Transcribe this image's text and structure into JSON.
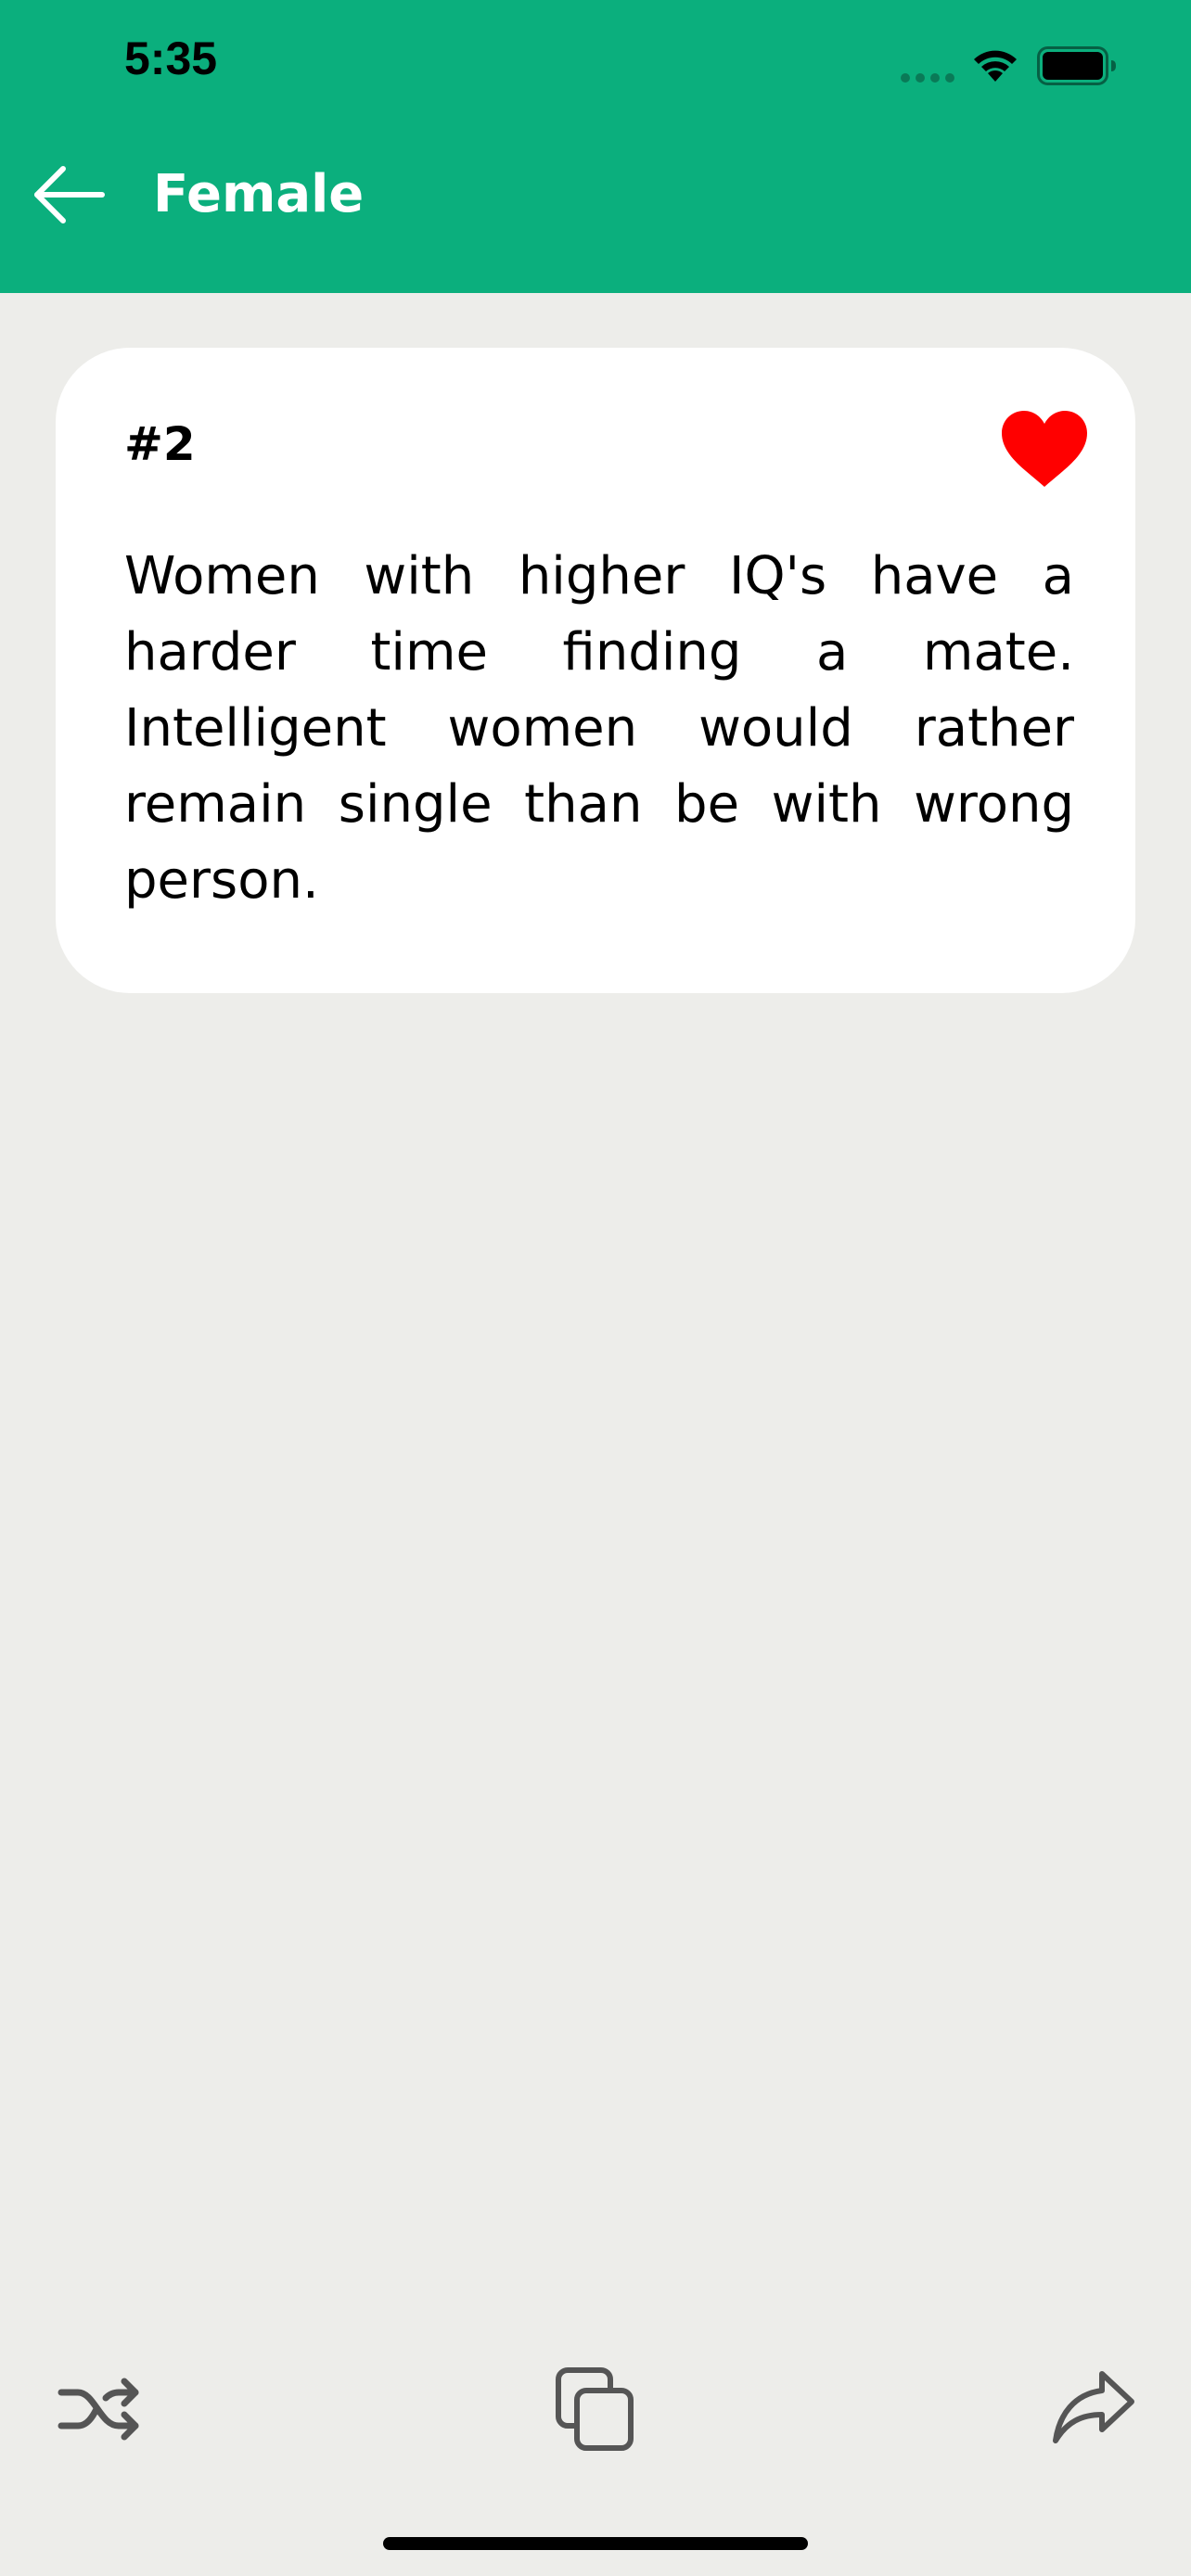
{
  "status_bar": {
    "time": "5:35",
    "icons": [
      "signal-dots-icon",
      "wifi-icon",
      "battery-icon"
    ]
  },
  "header": {
    "title": "Female",
    "back_icon": "arrow-left-icon",
    "background_color": "#0BAF7D"
  },
  "card": {
    "number": "#2",
    "text": "Women with higher IQ's have a harder time finding a mate. Intelligent women would rather remain single than be with wrong person.",
    "favorite_icon": "heart-icon",
    "favorite_color": "#FF0000",
    "favorited": true
  },
  "toolbar": {
    "icons": [
      "shuffle-icon",
      "copy-icon",
      "share-icon"
    ]
  },
  "colors": {
    "background": "#EDEDEA",
    "accent": "#0BAF7D",
    "icon": "#555555"
  }
}
